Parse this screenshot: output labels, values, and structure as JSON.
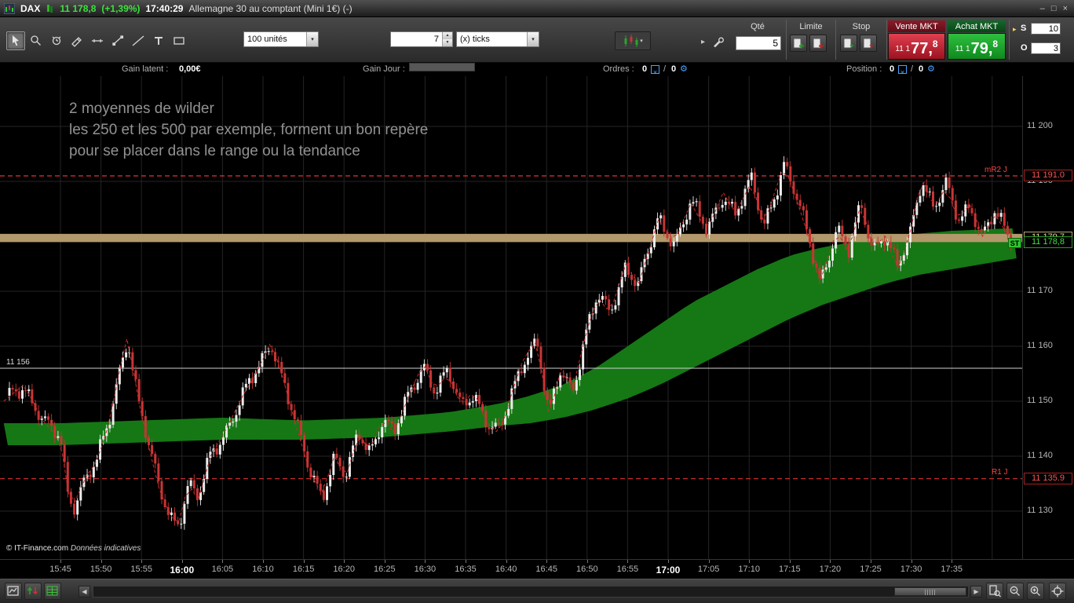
{
  "title_bar": {
    "symbol": "DAX",
    "price": "11 178,8",
    "change": "(+1,39%)",
    "time": "17:40:29",
    "instrument": "Allemagne 30 au comptant (Mini 1€) (-)",
    "minimize": "–",
    "restore": "□",
    "close": "×"
  },
  "toolbar": {
    "units_value": "100 unités",
    "ticks_count": "7",
    "ticks_unit": "(x) ticks"
  },
  "trading": {
    "qty_header": "Qté",
    "qty_value": "5",
    "limit_header": "Limite",
    "stop_header": "Stop",
    "sell_header": "Vente MKT",
    "sell_prefix": "11 1",
    "sell_main": "77,",
    "sell_sup": "8",
    "buy_header": "Achat MKT",
    "buy_prefix": "11 1",
    "buy_main": "79,",
    "buy_sup": "8",
    "s_label": "S",
    "s_value": "10",
    "o_label": "O",
    "o_value": "3"
  },
  "info_bar": {
    "gain_latent_label": "Gain latent :",
    "gain_latent_value": "0,00€",
    "gain_jour_label": "Gain Jour :",
    "orders_label": "Ordres :",
    "orders_count1": "0",
    "orders_count2": "0",
    "position_label": "Position :",
    "position_count1": "0",
    "position_count2": "0"
  },
  "annotation": {
    "line1": "2 moyennes de wilder",
    "line2": "les 250 et les 500 par exemple, forment un bon repère",
    "line3": "pour se placer dans le range ou la tendance"
  },
  "chart_labels": {
    "mr2": "mR2 J",
    "r1": "R1 J",
    "st": "ST",
    "left_level": "11 156"
  },
  "watermark": {
    "copyright": "© IT-Finance.com",
    "note": "Données indicatives"
  },
  "icons": {
    "dropdown": "▾",
    "spinner_up": "▲",
    "spinner_down": "▼",
    "scroll_left": "◀",
    "scroll_right": "▶",
    "chevron": "▸",
    "so_arrow": "▸",
    "cancel": "×",
    "gear": "⚙",
    "slash": "/"
  },
  "chart_data": {
    "type": "candlestick",
    "symbol": "DAX",
    "interval": "7 ticks",
    "x_unit": "minutes after 15:45",
    "x_start": -6.7,
    "x_end": 117.4,
    "candle_step_min": 0.4,
    "ylim": [
      11121,
      11209
    ],
    "x_tick_labels": [
      "15:45",
      "15:50",
      "15:55",
      "16:00",
      "16:05",
      "16:10",
      "16:15",
      "16:20",
      "16:25",
      "16:30",
      "16:35",
      "16:40",
      "16:45",
      "16:50",
      "16:55",
      "17:00",
      "17:05",
      "17:10",
      "17:15",
      "17:20",
      "17:25",
      "17:30",
      "17:35"
    ],
    "y_ticks": [
      {
        "price": 11130,
        "label": "11 130"
      },
      {
        "price": 11140,
        "label": "11 140"
      },
      {
        "price": 11150,
        "label": "11 150"
      },
      {
        "price": 11160,
        "label": "11 160"
      },
      {
        "price": 11170,
        "label": "11 170"
      },
      {
        "price": 11180,
        "label": "11 180"
      },
      {
        "price": 11190,
        "label": "11 190"
      },
      {
        "price": 11200,
        "label": "11 200"
      }
    ],
    "levels": {
      "mr2": 11191.0,
      "r1": 11135.9,
      "ref_line": 11156,
      "zone_center": 11179.7,
      "last_price": 11178.8
    },
    "tags": [
      {
        "label": "11 191.0",
        "price": 11191.0,
        "style": "red"
      },
      {
        "label": "11 179,7",
        "price": 11179.7,
        "style": "tan"
      },
      {
        "label": "11 178,8",
        "price": 11178.8,
        "style": "green"
      },
      {
        "label": "11 135.9",
        "price": 11135.9,
        "style": "red"
      }
    ],
    "price_anchors": [
      [
        -7,
        11150
      ],
      [
        -4.5,
        11153
      ],
      [
        -2,
        11146
      ],
      [
        0,
        11143
      ],
      [
        0.8,
        11134
      ],
      [
        1.6,
        11131
      ],
      [
        3,
        11136
      ],
      [
        4.5,
        11139
      ],
      [
        6,
        11146
      ],
      [
        7.5,
        11157
      ],
      [
        8.3,
        11162
      ],
      [
        9.5,
        11151
      ],
      [
        11,
        11141
      ],
      [
        12.2,
        11134
      ],
      [
        13.6,
        11129
      ],
      [
        14.6,
        11128
      ],
      [
        15.8,
        11135
      ],
      [
        17,
        11132
      ],
      [
        18.5,
        11140
      ],
      [
        20.5,
        11145
      ],
      [
        22.5,
        11151
      ],
      [
        24.5,
        11156
      ],
      [
        26,
        11161
      ],
      [
        27.5,
        11154
      ],
      [
        29,
        11146
      ],
      [
        30.8,
        11137
      ],
      [
        32.3,
        11133
      ],
      [
        33.8,
        11140
      ],
      [
        35.2,
        11136
      ],
      [
        36.8,
        11144
      ],
      [
        38.2,
        11141
      ],
      [
        39.8,
        11147
      ],
      [
        41.2,
        11144
      ],
      [
        43,
        11151
      ],
      [
        44.8,
        11157
      ],
      [
        46.2,
        11152
      ],
      [
        47.8,
        11155
      ],
      [
        49.5,
        11149
      ],
      [
        51,
        11152
      ],
      [
        52.6,
        11146
      ],
      [
        54.2,
        11144
      ],
      [
        55.8,
        11152
      ],
      [
        57.2,
        11158
      ],
      [
        58.8,
        11161
      ],
      [
        60.3,
        11147
      ],
      [
        61.8,
        11156
      ],
      [
        63.2,
        11152
      ],
      [
        64.8,
        11162
      ],
      [
        66.3,
        11169
      ],
      [
        67.8,
        11166
      ],
      [
        69.8,
        11175
      ],
      [
        71.3,
        11171
      ],
      [
        73.8,
        11183
      ],
      [
        75.8,
        11179
      ],
      [
        77.8,
        11186
      ],
      [
        79.8,
        11181
      ],
      [
        81.8,
        11188
      ],
      [
        83.3,
        11184
      ],
      [
        85.3,
        11190
      ],
      [
        86.8,
        11182
      ],
      [
        89.3,
        11193
      ],
      [
        90.8,
        11187
      ],
      [
        92.3,
        11180
      ],
      [
        93.8,
        11172
      ],
      [
        95.8,
        11181
      ],
      [
        97.3,
        11177
      ],
      [
        98.8,
        11186
      ],
      [
        100.3,
        11178
      ],
      [
        101.8,
        11180
      ],
      [
        103.3,
        11174
      ],
      [
        104.8,
        11180
      ],
      [
        106.3,
        11191
      ],
      [
        107.8,
        11185
      ],
      [
        109.3,
        11189
      ],
      [
        110.8,
        11183
      ],
      [
        112.3,
        11186
      ],
      [
        113.8,
        11180
      ],
      [
        115.3,
        11184
      ],
      [
        117.5,
        11179
      ]
    ],
    "band_upper": [
      [
        -7,
        11146
      ],
      [
        0,
        11146
      ],
      [
        10,
        11146.5
      ],
      [
        20,
        11147
      ],
      [
        30,
        11146.5
      ],
      [
        40,
        11147
      ],
      [
        48,
        11148
      ],
      [
        54,
        11149.5
      ],
      [
        58,
        11151
      ],
      [
        62,
        11153
      ],
      [
        66,
        11156
      ],
      [
        70,
        11160
      ],
      [
        74,
        11164
      ],
      [
        78,
        11168
      ],
      [
        82,
        11171
      ],
      [
        86,
        11174
      ],
      [
        90,
        11176.5
      ],
      [
        94,
        11178
      ],
      [
        98,
        11179
      ],
      [
        102,
        11180
      ],
      [
        106,
        11180.5
      ],
      [
        110,
        11181
      ],
      [
        118,
        11181.5
      ]
    ],
    "band_lower": [
      [
        -7,
        11142
      ],
      [
        0,
        11142
      ],
      [
        10,
        11142.5
      ],
      [
        20,
        11143
      ],
      [
        30,
        11143
      ],
      [
        40,
        11143.5
      ],
      [
        48,
        11144.5
      ],
      [
        54,
        11145.5
      ],
      [
        58,
        11146
      ],
      [
        62,
        11147
      ],
      [
        66,
        11148.5
      ],
      [
        70,
        11150.5
      ],
      [
        74,
        11153
      ],
      [
        78,
        11156
      ],
      [
        82,
        11159
      ],
      [
        86,
        11162
      ],
      [
        90,
        11165
      ],
      [
        94,
        11167.5
      ],
      [
        98,
        11169.5
      ],
      [
        102,
        11171.5
      ],
      [
        106,
        11173
      ],
      [
        110,
        11174
      ],
      [
        118,
        11176
      ]
    ],
    "colors": {
      "up": "#ececec",
      "down": "#c93535",
      "ma": "#cc2a2a",
      "band": "#157815",
      "zone": "#b2986a",
      "level_red": "#e23333",
      "ref_white": "#cfcfcf",
      "grid": "#242424"
    }
  }
}
